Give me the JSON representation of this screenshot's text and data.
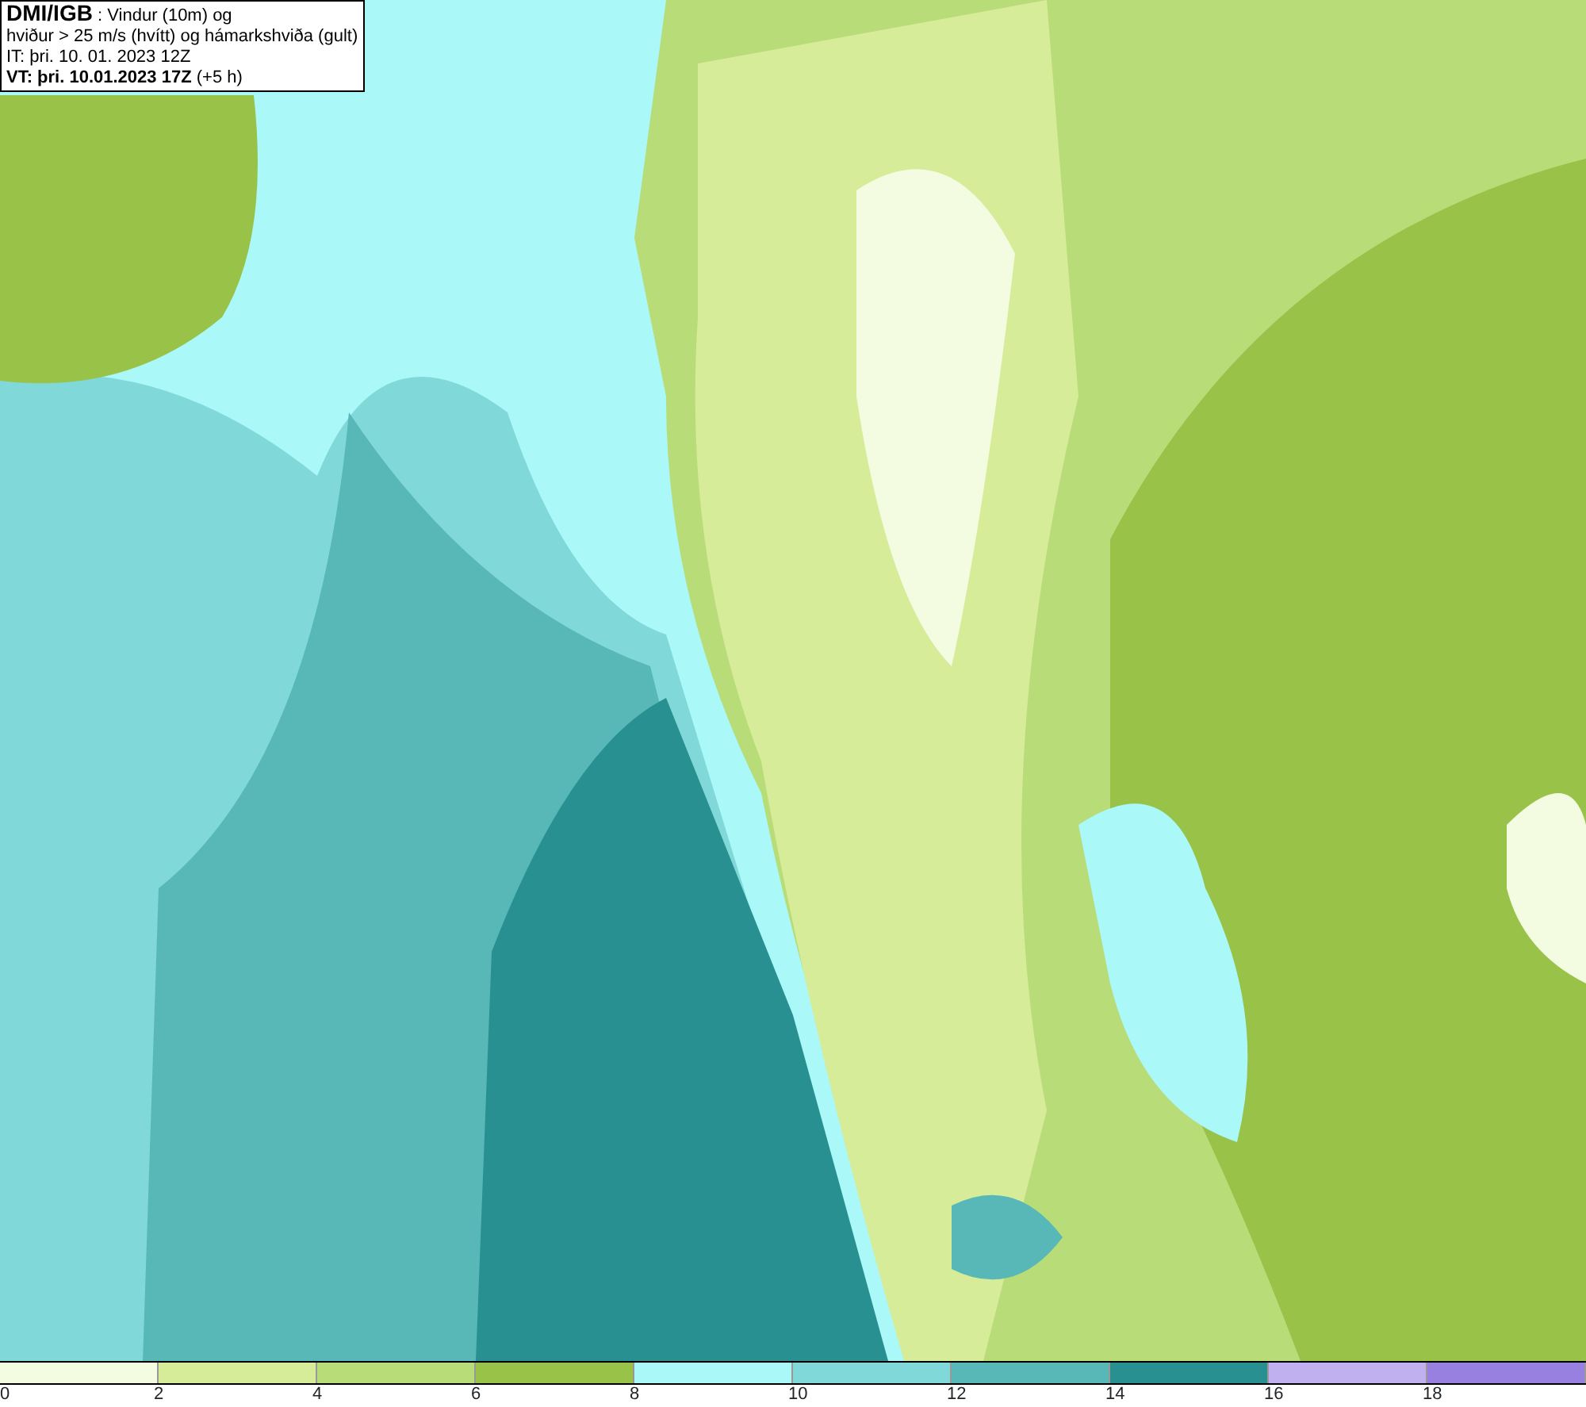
{
  "header": {
    "source": "DMI/IGB",
    "title": ": Vindur (10m) og",
    "subtitle": "hviður > 25 m/s (hvítt) og hámarkshviða (gult)",
    "initial_time": "IT: þri. 10. 01. 2023 12Z",
    "valid_time": "VT: þri. 10.01.2023 17Z",
    "lead": "(+5 h)"
  },
  "legend": {
    "swatches": [
      {
        "color": "#f3fbe0"
      },
      {
        "color": "#d6ec98"
      },
      {
        "color": "#b8dc78"
      },
      {
        "color": "#98c248"
      },
      {
        "color": "#aaf8f8"
      },
      {
        "color": "#80d8d8"
      },
      {
        "color": "#58b8b8"
      },
      {
        "color": "#289090"
      },
      {
        "color": "#c0b0f0"
      },
      {
        "color": "#9880e0"
      }
    ],
    "ticks": [
      "0",
      "2",
      "4",
      "6",
      "8",
      "10",
      "12",
      "14",
      "16",
      "18"
    ]
  }
}
